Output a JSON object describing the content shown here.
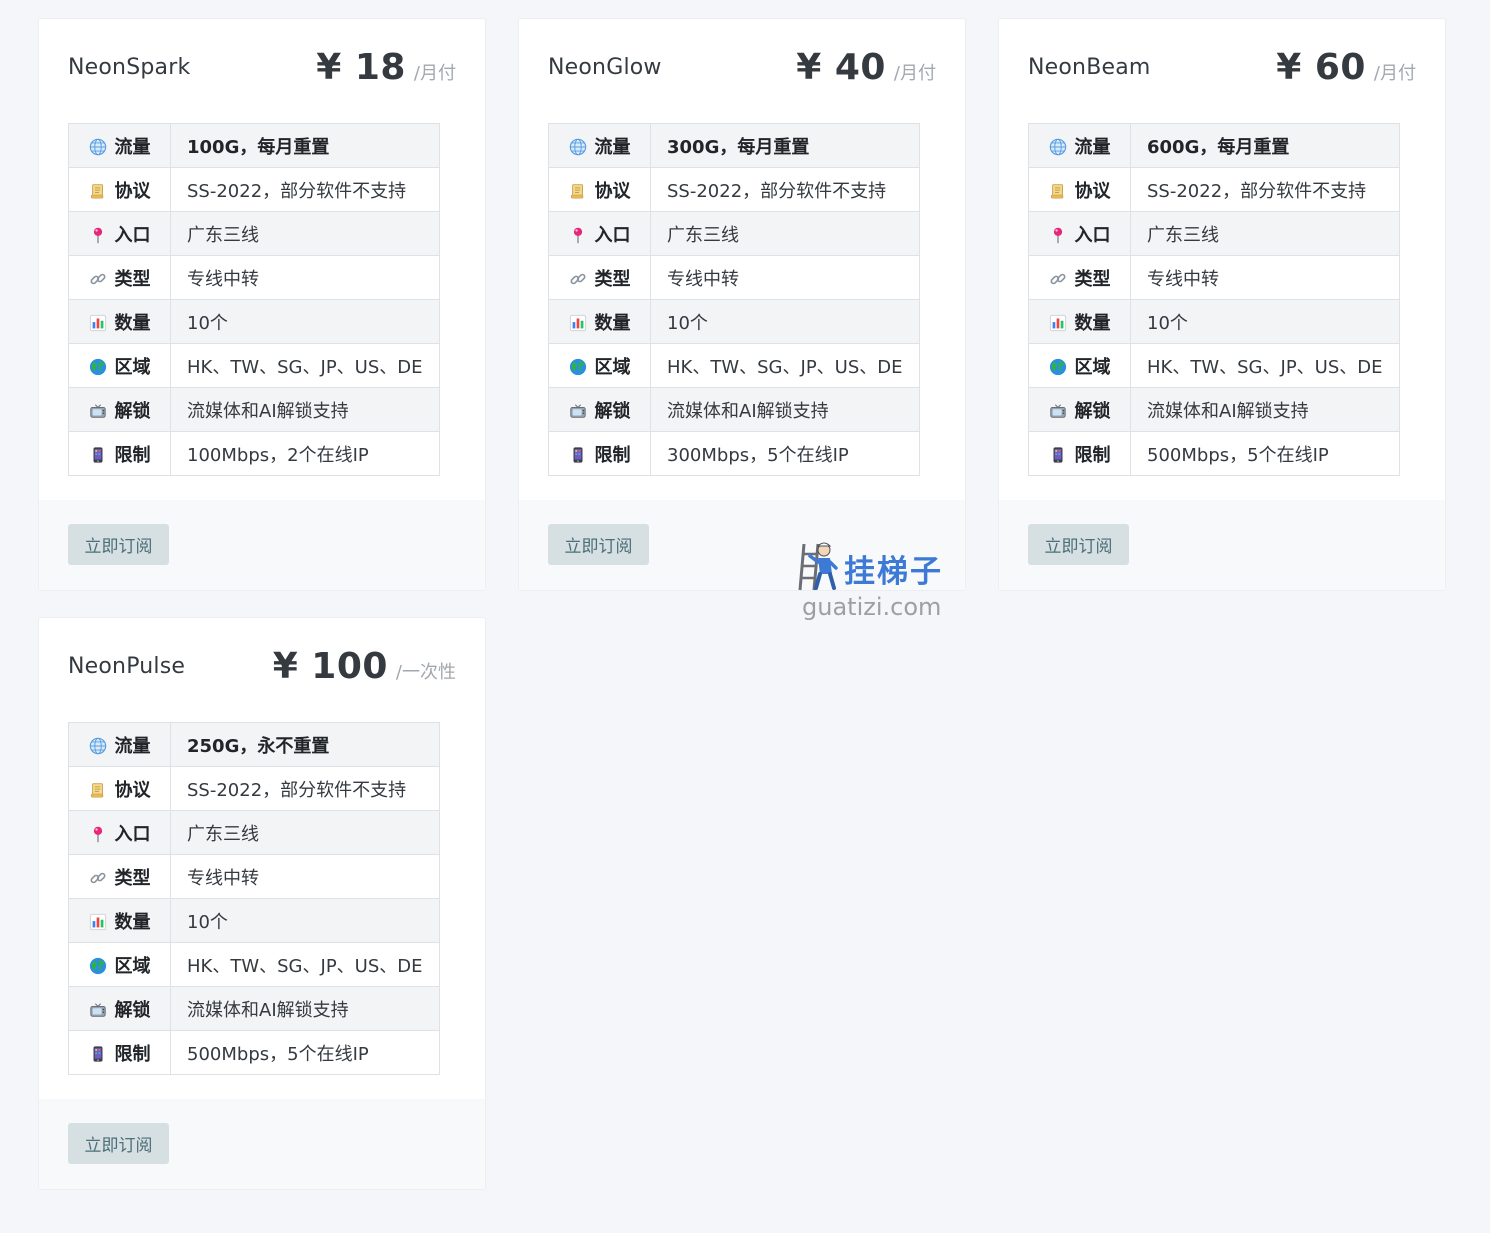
{
  "colors": {
    "page_bg": "#f4f6f9",
    "button_bg": "#d6dfe2",
    "button_text": "#4c6f7a",
    "watermark_blue": "#3d7ad6"
  },
  "spec_keys": {
    "traffic": "流量",
    "protocol": "协议",
    "entry": "入口",
    "type": "类型",
    "count": "数量",
    "region": "区域",
    "unlock": "解锁",
    "limit": "限制"
  },
  "icons": {
    "traffic": "globe-meridians-icon",
    "protocol": "scroll-icon",
    "entry": "pushpin-icon",
    "type": "link-icon",
    "count": "bar-chart-icon",
    "region": "earth-globe-icon",
    "unlock": "television-icon",
    "limit": "mobile-phone-icon"
  },
  "plans": [
    {
      "name": "NeonSpark",
      "price": "¥ 18",
      "period": "/月付",
      "traffic": "100G，每月重置",
      "protocol": "SS-2022，部分软件不支持",
      "entry": "广东三线",
      "type": "专线中转",
      "count": "10个",
      "region": "HK、TW、SG、JP、US、DE",
      "unlock": "流媒体和AI解锁支持",
      "limit": "100Mbps，2个在线IP",
      "button": "立即订阅"
    },
    {
      "name": "NeonGlow",
      "price": "¥ 40",
      "period": "/月付",
      "traffic": "300G，每月重置",
      "protocol": "SS-2022，部分软件不支持",
      "entry": "广东三线",
      "type": "专线中转",
      "count": "10个",
      "region": "HK、TW、SG、JP、US、DE",
      "unlock": "流媒体和AI解锁支持",
      "limit": "300Mbps，5个在线IP",
      "button": "立即订阅"
    },
    {
      "name": "NeonBeam",
      "price": "¥ 60",
      "period": "/月付",
      "traffic": "600G，每月重置",
      "protocol": "SS-2022，部分软件不支持",
      "entry": "广东三线",
      "type": "专线中转",
      "count": "10个",
      "region": "HK、TW、SG、JP、US、DE",
      "unlock": "流媒体和AI解锁支持",
      "limit": "500Mbps，5个在线IP",
      "button": "立即订阅"
    },
    {
      "name": "NeonPulse",
      "price": "¥ 100",
      "period": "/一次性",
      "traffic": "250G，永不重置",
      "protocol": "SS-2022，部分软件不支持",
      "entry": "广东三线",
      "type": "专线中转",
      "count": "10个",
      "region": "HK、TW、SG、JP、US、DE",
      "unlock": "流媒体和AI解锁支持",
      "limit": "500Mbps，5个在线IP",
      "button": "立即订阅"
    }
  ],
  "watermark": {
    "title": "挂梯子",
    "site": "guatizi.com"
  }
}
